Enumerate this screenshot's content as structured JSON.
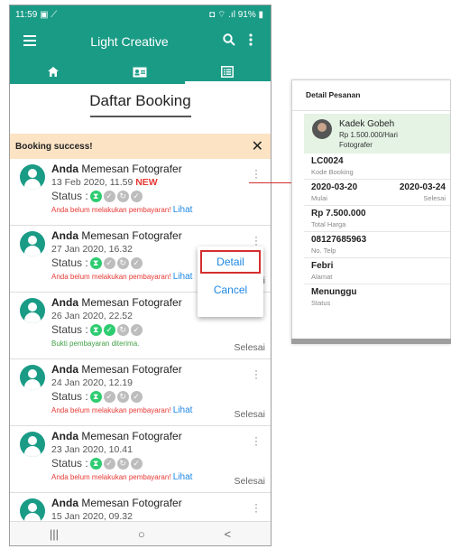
{
  "statusbar": {
    "time": "11:59",
    "left_icons": "▣ ⟋",
    "right_text": "◘ ⌔ .ıl 91% ▮"
  },
  "appbar": {
    "title": "Light Creative",
    "menu_icon": "hamburger-icon",
    "search_icon": "search-icon",
    "more_icon": "more-vert-icon"
  },
  "tabs": [
    {
      "icon": "home-icon",
      "active": false
    },
    {
      "icon": "id-card-icon",
      "active": false
    },
    {
      "icon": "list-icon",
      "active": true
    }
  ],
  "page": {
    "title": "Daftar Booking"
  },
  "toast": {
    "message": "Booking success!",
    "close": "✕"
  },
  "bookings": [
    {
      "actor": "Anda",
      "action": " Memesan Fotografer",
      "date": "13 Feb 2020, 11.59 ",
      "new_badge": "NEW",
      "status_label": "Status : ",
      "note": "Anda belum melakukan pembayaran! ",
      "link": "Lihat",
      "selesai": "",
      "paid": false
    },
    {
      "actor": "Anda",
      "action": " Memesan Fotografer",
      "date": "27 Jan 2020, 16.32",
      "new_badge": "",
      "status_label": "Status : ",
      "note": "Anda belum melakukan pembayaran! ",
      "link": "Lihat",
      "selesai": "Selesai",
      "paid": false
    },
    {
      "actor": "Anda",
      "action": " Memesan Fotografer",
      "date": "26 Jan 2020, 22.52",
      "new_badge": "",
      "status_label": "Status : ",
      "note": "Bukti pembayaran diterima.",
      "link": "",
      "selesai": "Selesai",
      "paid": true
    },
    {
      "actor": "Anda",
      "action": " Memesan Fotografer",
      "date": "24 Jan 2020, 12.19",
      "new_badge": "",
      "status_label": "Status : ",
      "note": "Anda belum melakukan pembayaran! ",
      "link": "Lihat",
      "selesai": "Selesai",
      "paid": false
    },
    {
      "actor": "Anda",
      "action": " Memesan Fotografer",
      "date": "23 Jan 2020, 10.41",
      "new_badge": "",
      "status_label": "Status : ",
      "note": "Anda belum melakukan pembayaran! ",
      "link": "Lihat",
      "selesai": "Selesai",
      "paid": false
    },
    {
      "actor": "Anda",
      "action": " Memesan Fotografer",
      "date": "15 Jan 2020, 09.32",
      "new_badge": "",
      "status_label": "",
      "note": "",
      "link": "",
      "selesai": "",
      "paid": false
    }
  ],
  "popup": {
    "detail": "Detail",
    "cancel": "Cancel"
  },
  "navbar": {
    "recent": "|||",
    "home": "○",
    "back": "<"
  },
  "detail_panel": {
    "title": "Detail Pesanan",
    "photographer": {
      "name": "Kadek Gobeh",
      "price": "Rp 1.500.000/Hari",
      "role": "Fotografer"
    },
    "code": {
      "value": "LC0024",
      "label": "Kode Booking"
    },
    "start": {
      "value": "2020-03-20",
      "label": "Mulai"
    },
    "end": {
      "value": "2020-03-24",
      "label": "Selesai"
    },
    "total": {
      "value": "Rp 7.500.000",
      "label": "Total Harga"
    },
    "phone": {
      "value": "08127685963",
      "label": "No. Telp"
    },
    "address": {
      "value": "Febri",
      "label": "Alamat"
    },
    "status": {
      "value": "Menunggu",
      "label": "Status"
    }
  },
  "colors": {
    "primary": "#1a9b86",
    "highlight": "#d32f2f",
    "link": "#1e88e5",
    "toast": "#fbe3c4"
  }
}
